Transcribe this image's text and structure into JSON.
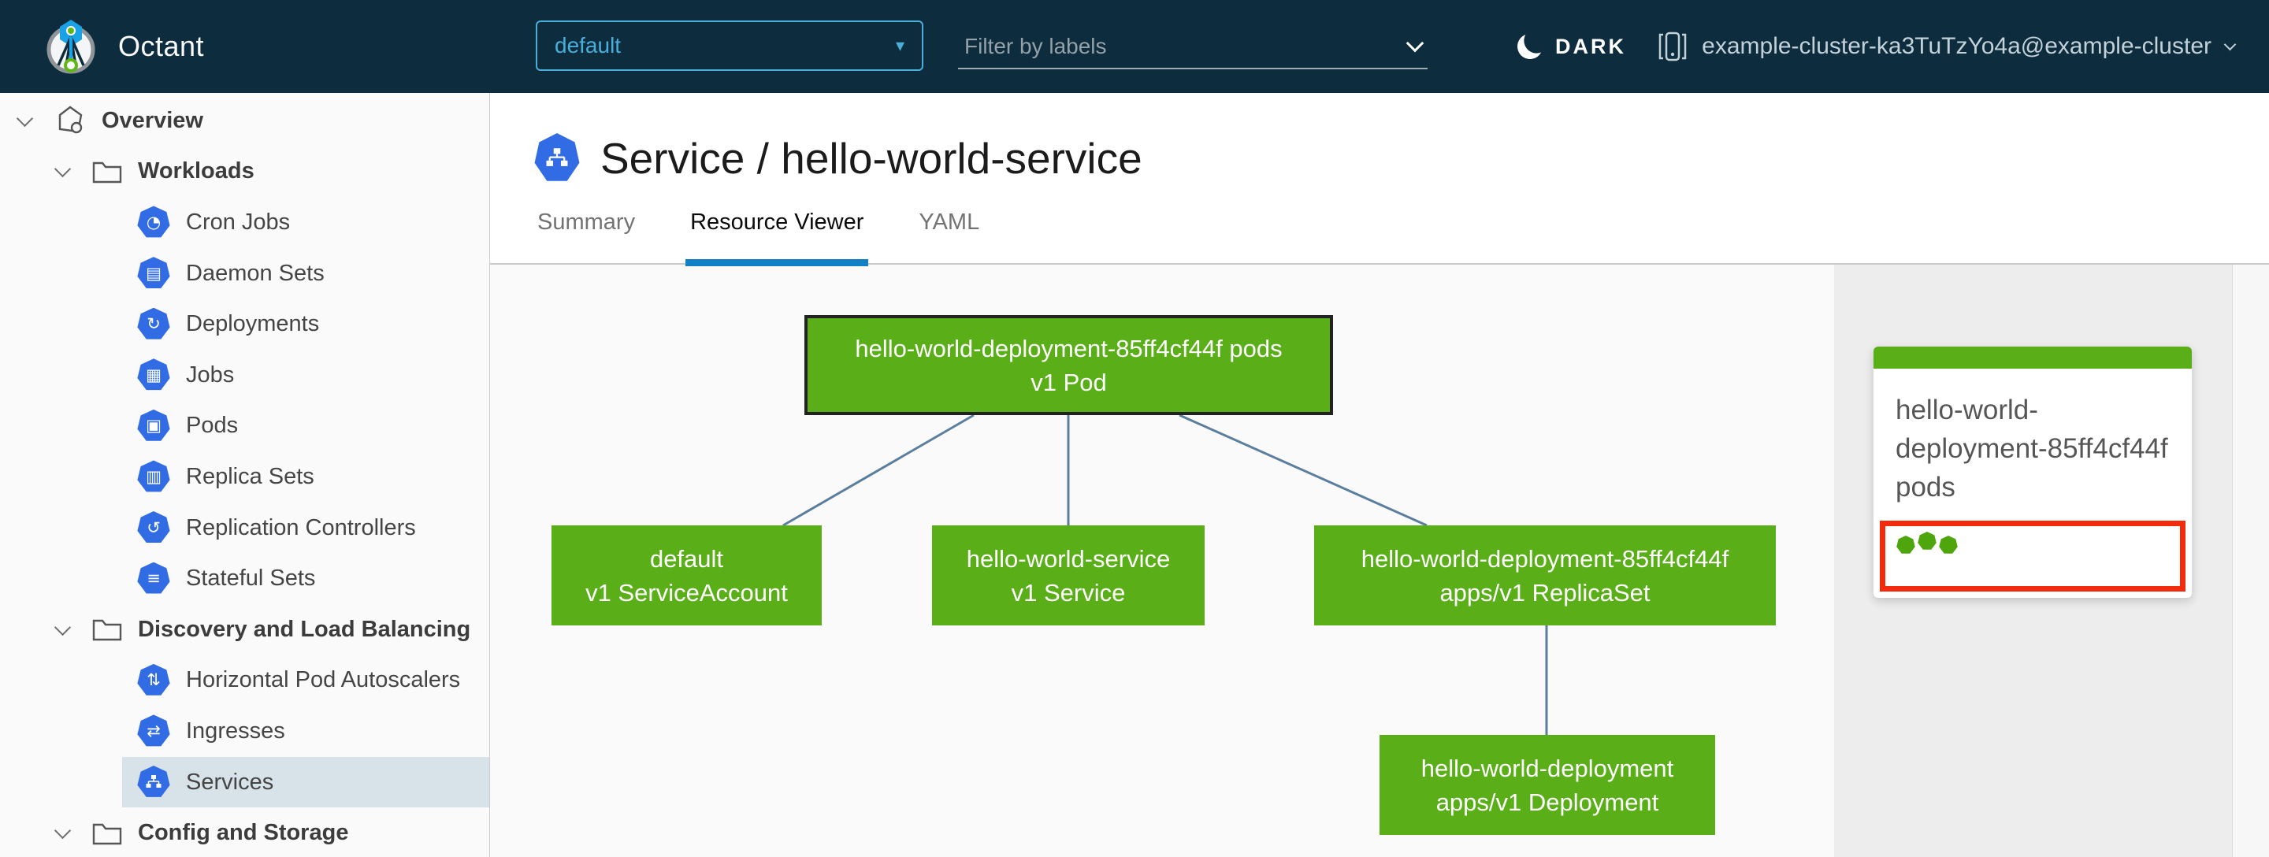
{
  "colors": {
    "header_bg": "#0d2c3e",
    "k8s_icon_blue": "#326ce5",
    "node_ok_green": "#5aaf19",
    "edge_blue": "#5b7e9e",
    "tab_active_underline": "#1180c4",
    "namespace_accent": "#49afd9",
    "selected_row_bg": "#d8e2e9",
    "highlight_red": "#f22b0c"
  },
  "header": {
    "app_name": "Octant",
    "namespace": "default",
    "filter_placeholder": "Filter by labels",
    "theme_label": "DARK",
    "cluster": "example-cluster-ka3TuTzYo4a@example-cluster"
  },
  "sidebar": {
    "items": [
      {
        "label": "Overview",
        "icon": "applications-icon",
        "level": 0,
        "expanded": true
      },
      {
        "label": "Workloads",
        "icon": "folder-icon",
        "level": 1,
        "expanded": true
      },
      {
        "label": "Cron Jobs",
        "icon": "cron-jobs-icon",
        "glyph": "◔",
        "level": 2
      },
      {
        "label": "Daemon Sets",
        "icon": "daemon-sets-icon",
        "glyph": "▤",
        "level": 2
      },
      {
        "label": "Deployments",
        "icon": "deployments-icon",
        "glyph": "↻",
        "level": 2
      },
      {
        "label": "Jobs",
        "icon": "jobs-icon",
        "glyph": "▦",
        "level": 2
      },
      {
        "label": "Pods",
        "icon": "pods-icon",
        "glyph": "▣",
        "level": 2
      },
      {
        "label": "Replica Sets",
        "icon": "replica-sets-icon",
        "glyph": "▥",
        "level": 2
      },
      {
        "label": "Replication Controllers",
        "icon": "replication-controllers-icon",
        "glyph": "↺",
        "level": 2
      },
      {
        "label": "Stateful Sets",
        "icon": "stateful-sets-icon",
        "glyph": "≡",
        "level": 2
      },
      {
        "label": "Discovery and Load Balancing",
        "icon": "folder-icon",
        "level": 1,
        "expanded": true
      },
      {
        "label": "Horizontal Pod Autoscalers",
        "icon": "hpa-icon",
        "glyph": "⇅",
        "level": 2
      },
      {
        "label": "Ingresses",
        "icon": "ingresses-icon",
        "glyph": "⇄",
        "level": 2
      },
      {
        "label": "Services",
        "icon": "services-icon",
        "level": 2,
        "selected": true
      },
      {
        "label": "Config and Storage",
        "icon": "folder-icon",
        "level": 1,
        "expanded": true
      }
    ]
  },
  "main": {
    "page_title": "Service / hello-world-service",
    "tabs": [
      {
        "label": "Summary",
        "active": false
      },
      {
        "label": "Resource Viewer",
        "active": true
      },
      {
        "label": "YAML",
        "active": false
      }
    ]
  },
  "graph": {
    "nodes": {
      "pod": {
        "name": "hello-world-deployment-85ff4cf44f pods",
        "kind": "v1 Pod",
        "status": "ok",
        "selected": true
      },
      "service_account": {
        "name": "default",
        "kind": "v1 ServiceAccount",
        "status": "ok"
      },
      "service": {
        "name": "hello-world-service",
        "kind": "v1 Service",
        "status": "ok"
      },
      "replica_set": {
        "name": "hello-world-deployment-85ff4cf44f",
        "kind": "apps/v1 ReplicaSet",
        "status": "ok"
      },
      "deployment": {
        "name": "hello-world-deployment",
        "kind": "apps/v1 Deployment",
        "status": "ok"
      }
    },
    "edges": [
      {
        "from": "pod",
        "to": "service_account"
      },
      {
        "from": "pod",
        "to": "service"
      },
      {
        "from": "pod",
        "to": "replica_set"
      },
      {
        "from": "replica_set",
        "to": "deployment"
      }
    ]
  },
  "detail_panel": {
    "card": {
      "title": "hello-world-deployment-85ff4cf44f pods",
      "pod_count": 3,
      "status": "ok"
    }
  }
}
